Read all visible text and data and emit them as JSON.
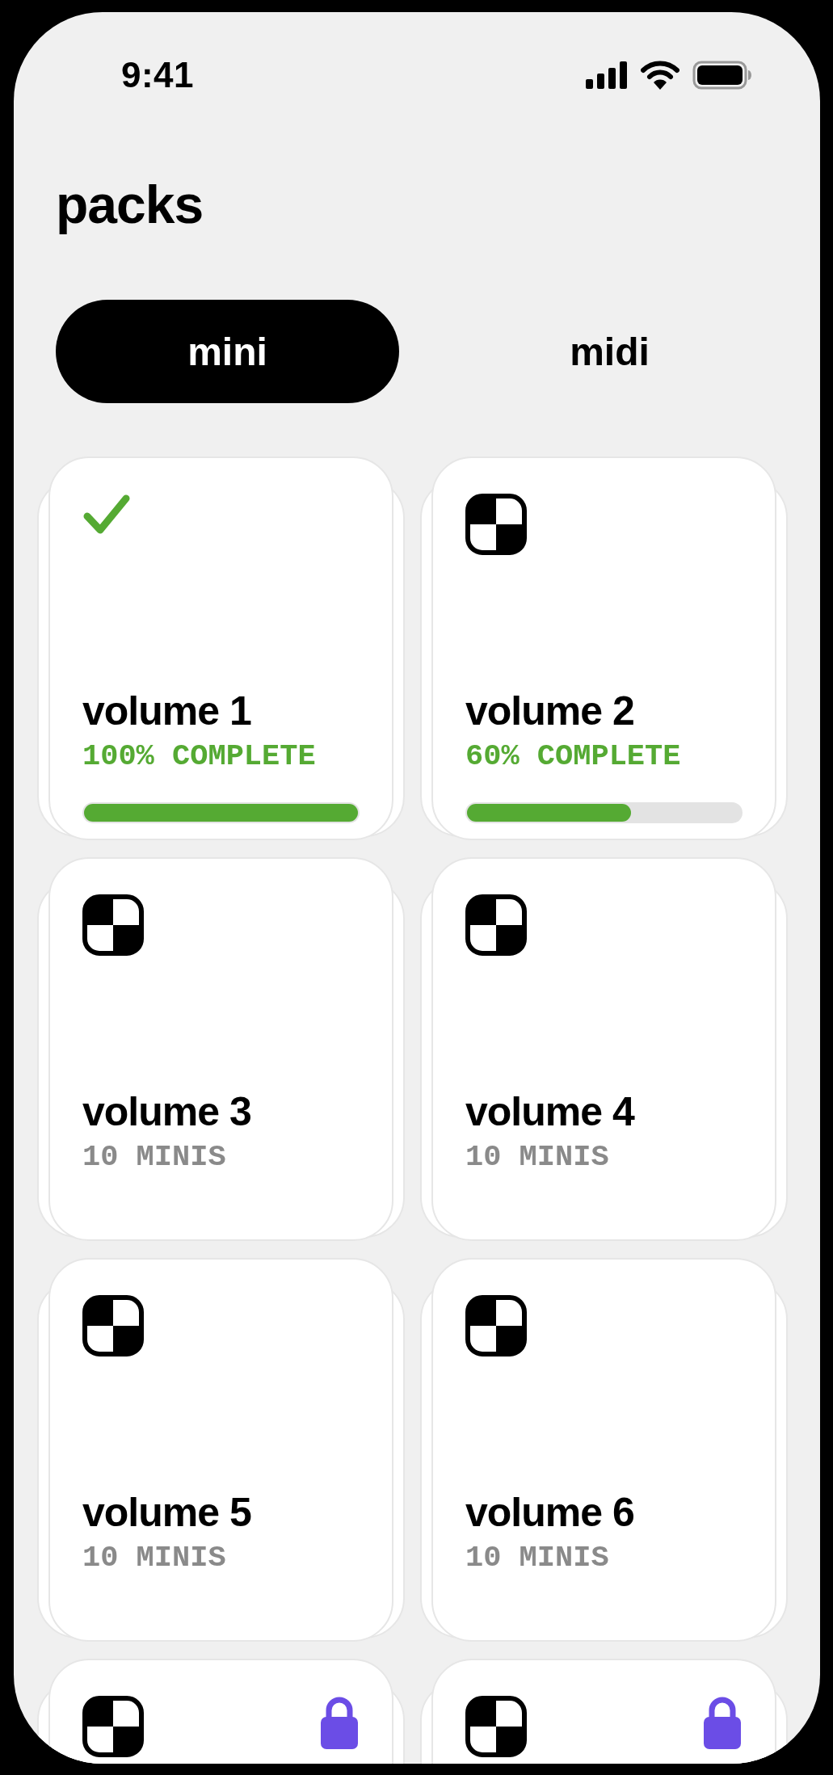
{
  "status_bar": {
    "time": "9:41"
  },
  "title": "packs",
  "tabs": [
    {
      "label": "mini",
      "selected": true
    },
    {
      "label": "midi",
      "selected": false
    }
  ],
  "cards": [
    {
      "kind": "progress",
      "title": "volume 1",
      "subtitle": "100% COMPLETE",
      "level": 1.0,
      "done": true,
      "locked": false
    },
    {
      "kind": "progress",
      "title": "volume 2",
      "subtitle": "60% COMPLETE",
      "level": 0.6,
      "done": false,
      "locked": false
    },
    {
      "kind": "count",
      "title": "volume 3",
      "subtitle": "10 MINIS",
      "done": false,
      "locked": false
    },
    {
      "kind": "count",
      "title": "volume 4",
      "subtitle": "10 MINIS",
      "done": false,
      "locked": false
    },
    {
      "kind": "count",
      "title": "volume 5",
      "subtitle": "10 MINIS",
      "done": false,
      "locked": false
    },
    {
      "kind": "count",
      "title": "volume 6",
      "subtitle": "10 MINIS",
      "done": false,
      "locked": false
    },
    {
      "kind": "count",
      "done": false,
      "locked": true
    },
    {
      "kind": "count",
      "done": false,
      "locked": true
    }
  ]
}
